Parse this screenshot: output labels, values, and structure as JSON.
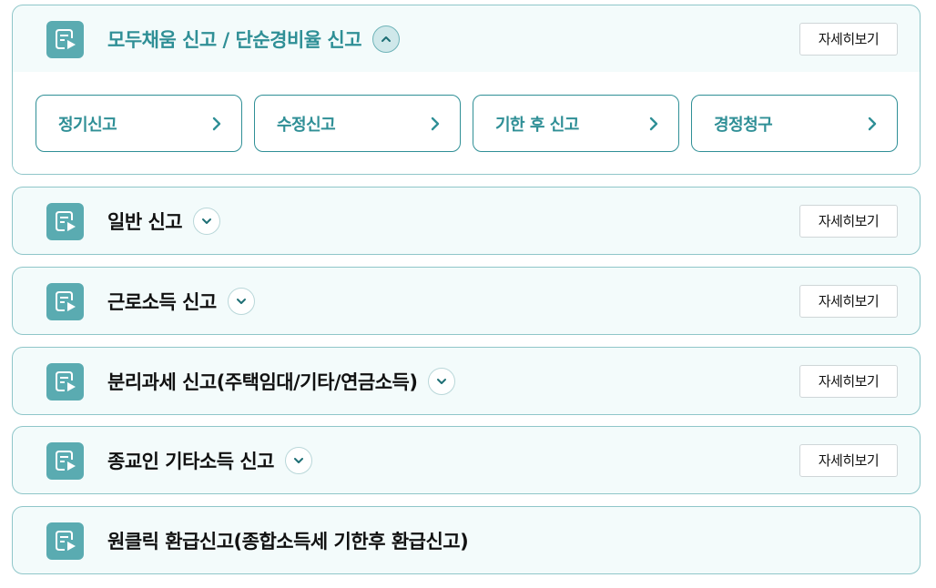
{
  "accent_color": "#2f8f96",
  "icon_bg_color": "#5aabb1",
  "detail_label": "자세히보기",
  "sections": [
    {
      "title": "모두채움 신고 / 단순경비율 신고",
      "expanded": true,
      "toggle_icon": "chevron-up-icon",
      "has_detail": true,
      "sub_items": [
        {
          "label": "정기신고"
        },
        {
          "label": "수정신고"
        },
        {
          "label": "기한 후 신고"
        },
        {
          "label": "경정청구"
        }
      ]
    },
    {
      "title": "일반 신고",
      "expanded": false,
      "toggle_icon": "chevron-down-icon",
      "has_detail": true
    },
    {
      "title": "근로소득 신고",
      "expanded": false,
      "toggle_icon": "chevron-down-icon",
      "has_detail": true
    },
    {
      "title": "분리과세 신고(주택임대/기타/연금소득)",
      "expanded": false,
      "toggle_icon": "chevron-down-icon",
      "has_detail": true
    },
    {
      "title": "종교인 기타소득 신고",
      "expanded": false,
      "toggle_icon": "chevron-down-icon",
      "has_detail": true
    },
    {
      "title": "원클릭 환급신고(종합소득세 기한후 환급신고)",
      "expanded": false,
      "has_detail": false
    }
  ]
}
